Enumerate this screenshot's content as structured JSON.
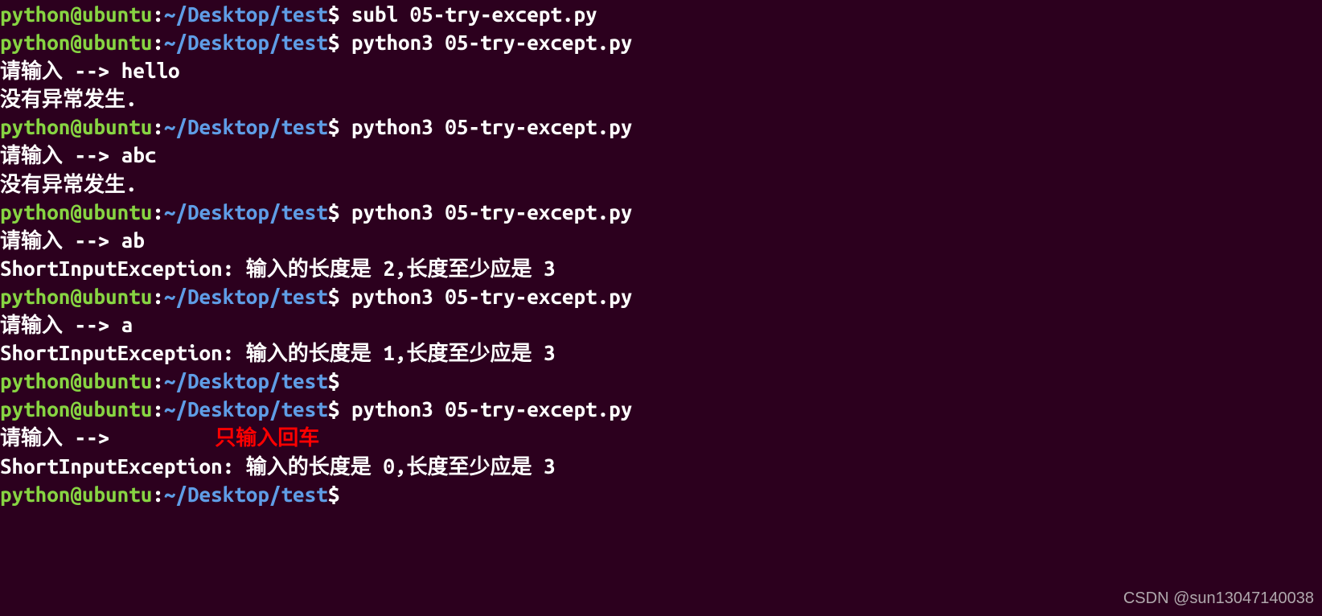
{
  "prompt": {
    "user": "python@ubuntu",
    "colon": ":",
    "path": "~/Desktop/test",
    "dollar": "$"
  },
  "lines": [
    {
      "type": "prompt",
      "cmd": "subl 05-try-except.py"
    },
    {
      "type": "prompt",
      "cmd": "python3 05-try-except.py"
    },
    {
      "type": "out",
      "text": "请输入 --> hello"
    },
    {
      "type": "out",
      "text": "没有异常发生."
    },
    {
      "type": "prompt",
      "cmd": "python3 05-try-except.py"
    },
    {
      "type": "out",
      "text": "请输入 --> abc"
    },
    {
      "type": "out",
      "text": "没有异常发生."
    },
    {
      "type": "prompt",
      "cmd": "python3 05-try-except.py"
    },
    {
      "type": "out",
      "text": "请输入 --> ab"
    },
    {
      "type": "out",
      "text": "ShortInputException: 输入的长度是 2,长度至少应是 3"
    },
    {
      "type": "prompt",
      "cmd": "python3 05-try-except.py"
    },
    {
      "type": "out",
      "text": "请输入 --> a"
    },
    {
      "type": "out",
      "text": "ShortInputException: 输入的长度是 1,长度至少应是 3"
    },
    {
      "type": "prompt",
      "cmd": ""
    },
    {
      "type": "prompt",
      "cmd": "python3 05-try-except.py"
    },
    {
      "type": "out-annot",
      "text": "请输入 --> ",
      "annot": "只输入回车"
    },
    {
      "type": "out",
      "text": "ShortInputException: 输入的长度是 0,长度至少应是 3"
    },
    {
      "type": "prompt",
      "cmd": ""
    }
  ],
  "watermark": "CSDN @sun13047140038"
}
